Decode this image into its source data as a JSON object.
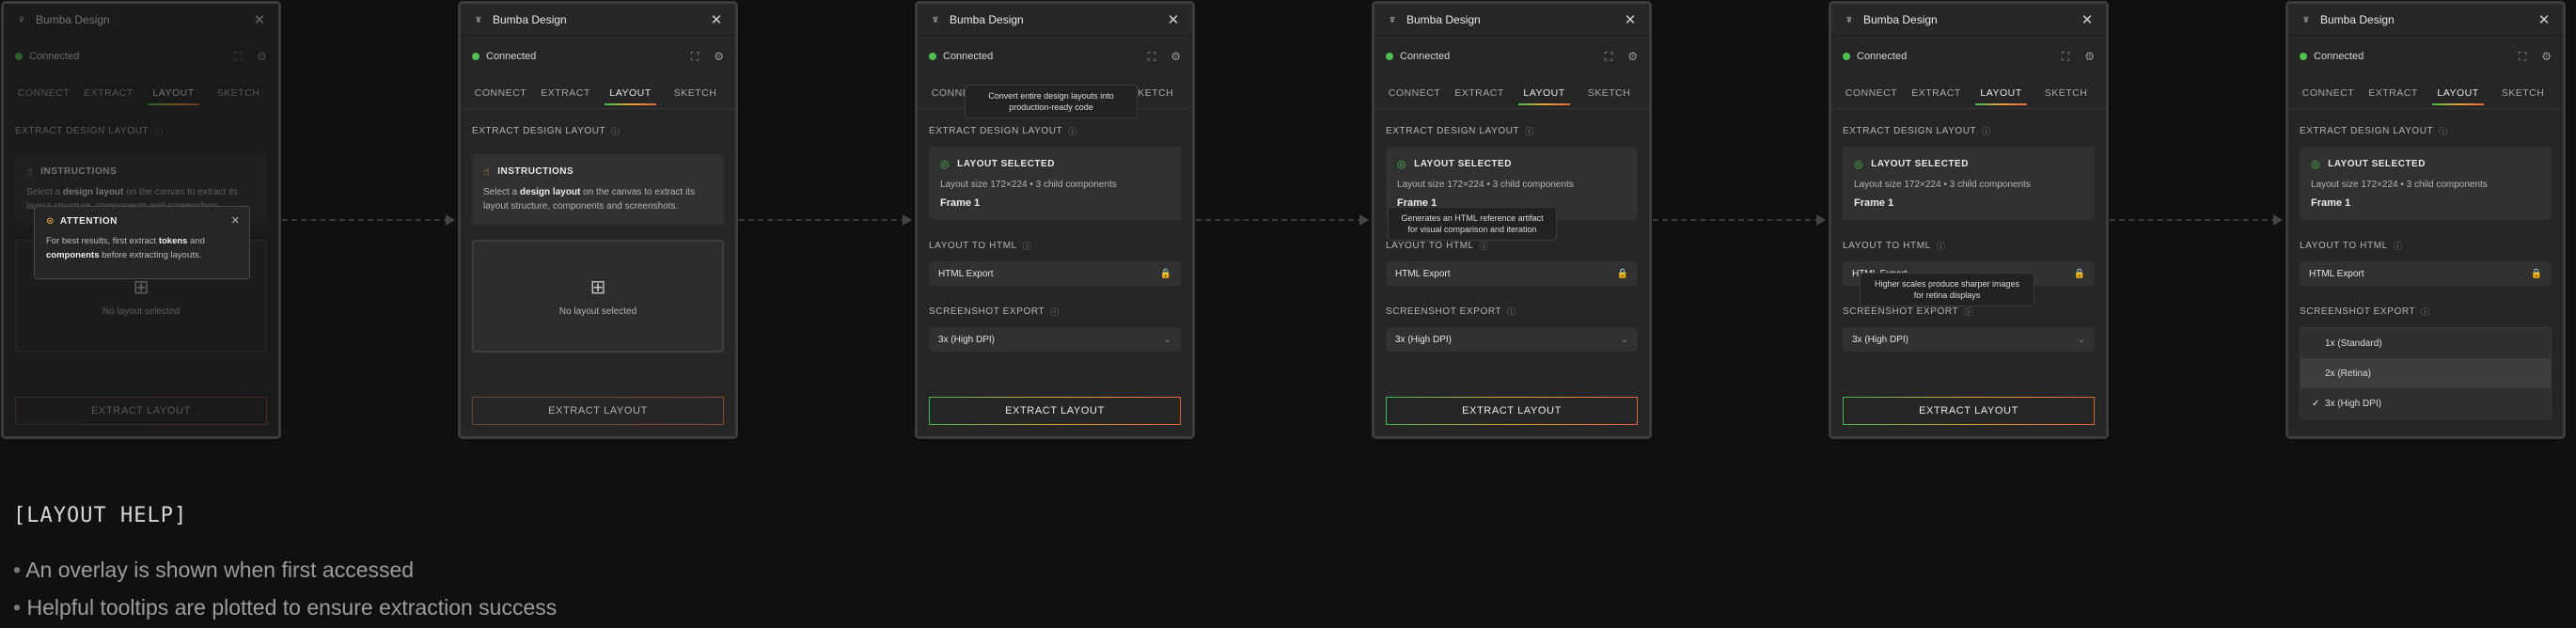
{
  "app_title": "Bumba Design",
  "status": "Connected",
  "tabs": [
    "CONNECT",
    "EXTRACT",
    "LAYOUT",
    "SKETCH"
  ],
  "section_extract": "EXTRACT DESIGN LAYOUT",
  "instructions": {
    "title": "INSTRUCTIONS",
    "text_1": "Select a ",
    "text_bold": "design layout",
    "text_2": " on the canvas to extract its layout structure, components and screenshots."
  },
  "empty_state": "No layout selected",
  "layout_selected": {
    "title": "LAYOUT SELECTED",
    "meta": "Layout size 172×224 • 3 child components",
    "frame": "Frame 1"
  },
  "section_html": "LAYOUT TO HTML",
  "html_export": "HTML Export",
  "section_screenshot": "SCREENSHOT EXPORT",
  "screenshot_value": "3x (High DPI)",
  "extract_button": "EXTRACT LAYOUT",
  "attention": {
    "title": "ATTENTION",
    "text_1": "For best results, first extract ",
    "bold_1": "tokens",
    "text_2": " and ",
    "bold_2": "components",
    "text_3": " before extracting layouts."
  },
  "tooltips": {
    "layout": "Convert entire design layouts into production-ready code",
    "html": "Generates an HTML reference artifact for visual comparison and iteration",
    "screenshot": "Higher scales produce sharper images for retina displays"
  },
  "dropdown_options": [
    "1x (Standard)",
    "2x (Retina)",
    "3x (High DPI)"
  ],
  "help": {
    "title": "[LAYOUT HELP]",
    "items": [
      "An overlay is shown when first accessed",
      "Helpful tooltips are plotted to ensure extraction success"
    ]
  },
  "icons": {
    "app": "palm-tree-icon",
    "close": "close-icon",
    "expand": "expand-icon",
    "settings": "gear-icon",
    "info": "info-icon",
    "lock": "lock-icon",
    "chevron": "chevron-down-icon",
    "check": "check-circle-icon",
    "grid": "grid-icon",
    "warning": "warning-icon"
  },
  "colors": {
    "status_green": "#4fbf4f",
    "accent_start": "#3fb950",
    "accent_mid": "#e6a23c",
    "accent_end": "#e0663a"
  }
}
